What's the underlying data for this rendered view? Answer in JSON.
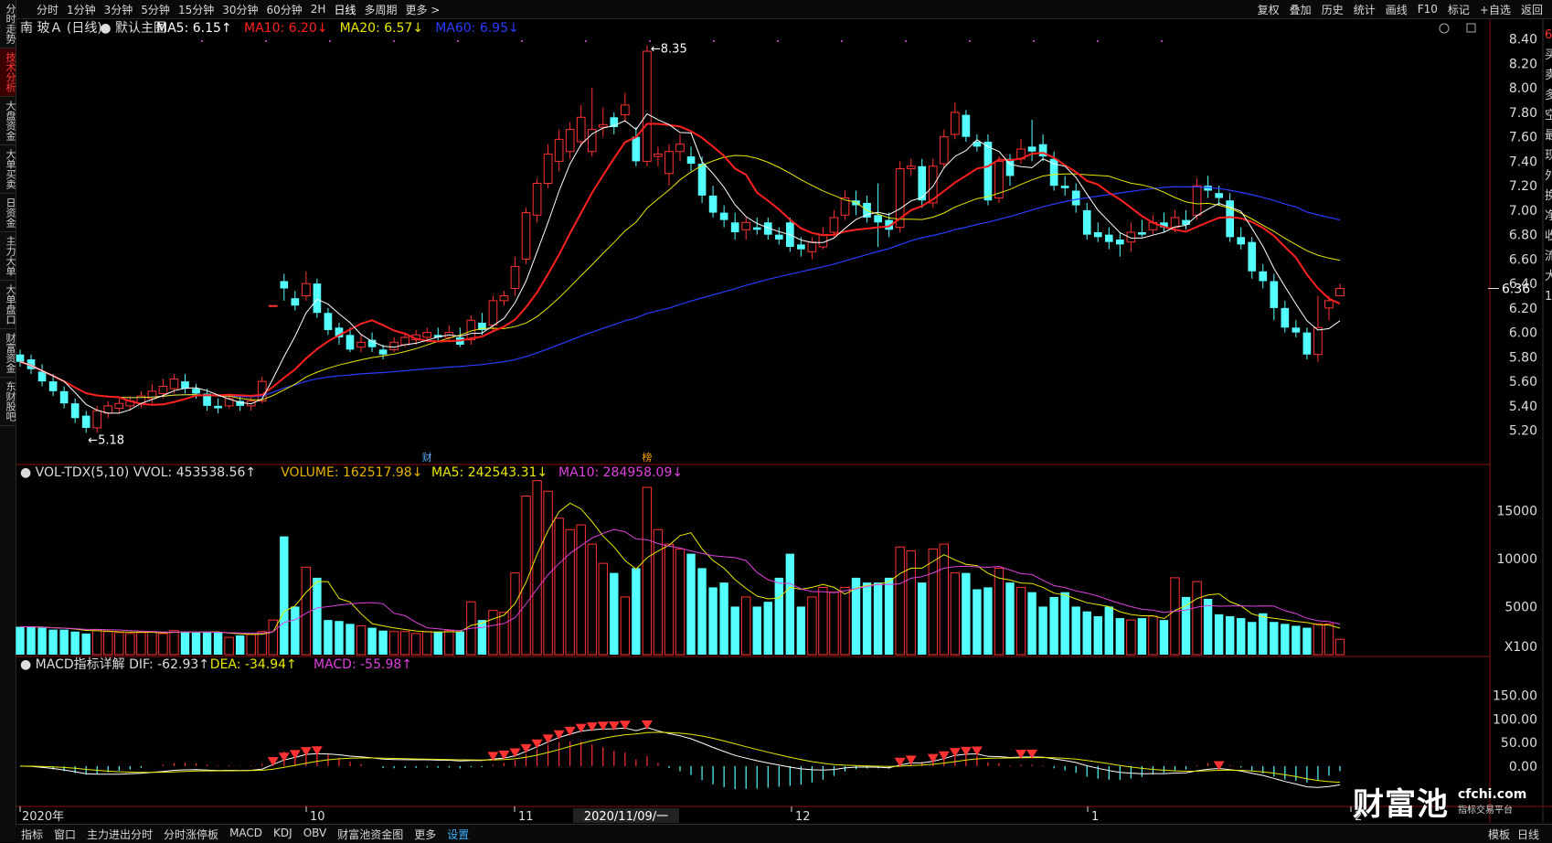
{
  "period_tabs": [
    "分时",
    "1分钟",
    "3分钟",
    "5分钟",
    "15分钟",
    "30分钟",
    "60分钟",
    "2H",
    "日线",
    "多周期",
    "更多 >"
  ],
  "active_period": "日线",
  "tool_tabs": [
    "复权",
    "叠加",
    "历史",
    "统计",
    "画线",
    "F10",
    "标记",
    "+自选",
    "返回"
  ],
  "sidebar": [
    "分时走势",
    "技术分析",
    "大盘资金",
    "大单买卖",
    "日资金",
    "主力大单",
    "大单盘口",
    "财富资金",
    "东财股吧"
  ],
  "active_side": "技术分析",
  "main_legend": [
    {
      "text": "南 玻Ａ (日线)",
      "color": "#dddddd"
    },
    {
      "text": "● 默认主图",
      "color": "#dddddd"
    },
    {
      "text": "MA5: 6.15↑",
      "color": "#ffffff"
    },
    {
      "text": "MA10: 6.20↓",
      "color": "#ff2020"
    },
    {
      "text": "MA20: 6.57↓",
      "color": "#e8e800"
    },
    {
      "text": "MA60: 6.95↓",
      "color": "#2a3cff"
    }
  ],
  "vol_legend": [
    {
      "text": "● VOL-TDX(5,10) VVOL: 453538.56↑",
      "color": "#dddddd"
    },
    {
      "text": "VOLUME: 162517.98↓",
      "color": "#e8b000"
    },
    {
      "text": "MA5: 242543.31↓",
      "color": "#e8e800"
    },
    {
      "text": "MA10: 284958.09↓",
      "color": "#e040e0"
    }
  ],
  "macd_legend": [
    {
      "text": "● MACD指标详解 DIF: -62.93↑",
      "color": "#dddddd"
    },
    {
      "text": "DEA: -34.94↑",
      "color": "#e8e800"
    },
    {
      "text": "MACD: -55.98↑",
      "color": "#e040e0"
    }
  ],
  "price_axis": [
    "8.40",
    "8.20",
    "8.00",
    "7.80",
    "7.60",
    "7.40",
    "7.20",
    "7.00",
    "6.80",
    "6.60",
    "6.40",
    "6.20",
    "6.00",
    "5.80",
    "5.60",
    "5.40",
    "5.20"
  ],
  "current_price": "6.36",
  "high_label": "8.35",
  "low_label": "5.18",
  "vol_axis": [
    "15000",
    "10000",
    "5000"
  ],
  "vol_unit": "X100",
  "macd_axis": [
    "150.00",
    "100.00",
    "50.00",
    "0.00"
  ],
  "date_axis": [
    "2020年",
    "10",
    "11",
    "2020/11/09/一",
    "12",
    "1",
    "2"
  ],
  "markers": {
    "cai": "财",
    "bang": "榜"
  },
  "right_edge_chars": [
    "6",
    "买",
    "卖",
    "多",
    "空",
    "最",
    "现",
    "外",
    "换",
    "净",
    "收",
    "流",
    "大",
    "1"
  ],
  "bottom_tabs": [
    "指标",
    "窗口",
    "主力进出分时",
    "分时涨停板",
    "MACD",
    "KDJ",
    "OBV",
    "财富池资金图",
    "更多",
    "设置"
  ],
  "bottom_right_tabs": [
    "模板",
    "日线"
  ],
  "watermark": {
    "main": "财富池",
    "url": "cfchi.com",
    "sub": "指标交易平台"
  },
  "chart_data": {
    "type": "candlestick",
    "title": "南 玻Ａ (日线)",
    "ylim": [
      5.1,
      8.45
    ],
    "candles": [
      [
        5.82,
        5.76,
        5.86,
        5.72
      ],
      [
        5.78,
        5.7,
        5.82,
        5.66
      ],
      [
        5.68,
        5.6,
        5.74,
        5.56
      ],
      [
        5.6,
        5.52,
        5.66,
        5.48
      ],
      [
        5.52,
        5.42,
        5.56,
        5.38
      ],
      [
        5.42,
        5.3,
        5.46,
        5.26
      ],
      [
        5.32,
        5.22,
        5.36,
        5.18
      ],
      [
        5.22,
        5.36,
        5.4,
        5.18
      ],
      [
        5.34,
        5.4,
        5.44,
        5.3
      ],
      [
        5.38,
        5.42,
        5.46,
        5.34
      ],
      [
        5.4,
        5.44,
        5.48,
        5.36
      ],
      [
        5.42,
        5.48,
        5.52,
        5.38
      ],
      [
        5.46,
        5.52,
        5.58,
        5.42
      ],
      [
        5.5,
        5.56,
        5.62,
        5.46
      ],
      [
        5.54,
        5.62,
        5.66,
        5.5
      ],
      [
        5.6,
        5.54,
        5.66,
        5.5
      ],
      [
        5.54,
        5.5,
        5.58,
        5.46
      ],
      [
        5.5,
        5.4,
        5.54,
        5.36
      ],
      [
        5.4,
        5.38,
        5.46,
        5.34
      ],
      [
        5.4,
        5.46,
        5.5,
        5.38
      ],
      [
        5.44,
        5.4,
        5.48,
        5.36
      ],
      [
        5.4,
        5.44,
        5.48,
        5.36
      ],
      [
        5.44,
        5.6,
        5.64,
        5.42
      ],
      [
        6.22,
        6.22,
        6.22,
        6.22
      ],
      [
        6.42,
        6.36,
        6.48,
        6.26
      ],
      [
        6.28,
        6.22,
        6.34,
        6.18
      ],
      [
        6.3,
        6.4,
        6.5,
        6.26
      ],
      [
        6.4,
        6.16,
        6.44,
        6.12
      ],
      [
        6.16,
        6.02,
        6.2,
        5.98
      ],
      [
        6.04,
        5.96,
        6.08,
        5.9
      ],
      [
        5.98,
        5.86,
        6.04,
        5.84
      ],
      [
        5.88,
        5.92,
        5.98,
        5.84
      ],
      [
        5.94,
        5.88,
        6.0,
        5.84
      ],
      [
        5.86,
        5.82,
        5.9,
        5.78
      ],
      [
        5.86,
        5.92,
        5.96,
        5.84
      ],
      [
        5.9,
        5.96,
        6.0,
        5.88
      ],
      [
        5.94,
        5.98,
        6.02,
        5.9
      ],
      [
        5.96,
        6.0,
        6.04,
        5.92
      ],
      [
        5.98,
        5.96,
        6.04,
        5.92
      ],
      [
        5.96,
        6.0,
        6.06,
        5.94
      ],
      [
        5.96,
        5.9,
        6.04,
        5.88
      ],
      [
        5.94,
        6.1,
        6.14,
        5.9
      ],
      [
        6.08,
        6.02,
        6.16,
        5.98
      ],
      [
        6.06,
        6.26,
        6.3,
        6.02
      ],
      [
        6.26,
        6.3,
        6.34,
        6.22
      ],
      [
        6.36,
        6.54,
        6.62,
        6.3
      ],
      [
        6.6,
        6.98,
        7.02,
        6.56
      ],
      [
        6.96,
        7.22,
        7.26,
        6.9
      ],
      [
        7.22,
        7.46,
        7.54,
        7.18
      ],
      [
        7.4,
        7.58,
        7.66,
        7.32
      ],
      [
        7.48,
        7.66,
        7.72,
        7.42
      ],
      [
        7.56,
        7.76,
        7.86,
        7.52
      ],
      [
        7.48,
        7.66,
        8.0,
        7.44
      ],
      [
        7.68,
        7.7,
        7.84,
        7.6
      ],
      [
        7.76,
        7.68,
        7.8,
        7.62
      ],
      [
        7.78,
        7.86,
        7.96,
        7.72
      ],
      [
        7.6,
        7.4,
        7.68,
        7.36
      ],
      [
        7.4,
        8.3,
        8.35,
        7.36
      ],
      [
        7.44,
        7.46,
        7.52,
        7.36
      ],
      [
        7.3,
        7.48,
        7.54,
        7.2
      ],
      [
        7.48,
        7.54,
        7.62,
        7.4
      ],
      [
        7.44,
        7.38,
        7.52,
        7.32
      ],
      [
        7.38,
        7.12,
        7.44,
        7.06
      ],
      [
        7.12,
        6.98,
        7.2,
        6.94
      ],
      [
        6.98,
        6.92,
        7.04,
        6.86
      ],
      [
        6.9,
        6.82,
        6.98,
        6.76
      ],
      [
        6.84,
        6.9,
        6.94,
        6.76
      ],
      [
        6.86,
        6.84,
        6.94,
        6.8
      ],
      [
        6.9,
        6.8,
        6.94,
        6.76
      ],
      [
        6.8,
        6.76,
        6.86,
        6.72
      ],
      [
        6.9,
        6.7,
        6.94,
        6.66
      ],
      [
        6.72,
        6.68,
        6.78,
        6.62
      ],
      [
        6.66,
        6.74,
        6.78,
        6.6
      ],
      [
        6.7,
        6.8,
        6.86,
        6.68
      ],
      [
        6.82,
        6.94,
        7.0,
        6.78
      ],
      [
        6.96,
        7.1,
        7.16,
        6.92
      ],
      [
        7.08,
        7.04,
        7.16,
        6.96
      ],
      [
        7.06,
        6.94,
        7.12,
        6.9
      ],
      [
        6.96,
        6.9,
        7.22,
        6.7
      ],
      [
        6.92,
        6.84,
        6.98,
        6.78
      ],
      [
        6.86,
        7.34,
        7.4,
        6.82
      ],
      [
        7.34,
        7.36,
        7.42,
        7.28
      ],
      [
        7.36,
        7.08,
        7.42,
        7.02
      ],
      [
        7.06,
        7.36,
        7.42,
        7.02
      ],
      [
        7.38,
        7.6,
        7.66,
        7.34
      ],
      [
        7.62,
        7.8,
        7.88,
        7.58
      ],
      [
        7.78,
        7.6,
        7.82,
        7.56
      ],
      [
        7.56,
        7.52,
        7.62,
        7.48
      ],
      [
        7.56,
        7.08,
        7.62,
        7.04
      ],
      [
        7.1,
        7.4,
        7.44,
        7.06
      ],
      [
        7.42,
        7.28,
        7.46,
        7.2
      ],
      [
        7.42,
        7.5,
        7.58,
        7.38
      ],
      [
        7.52,
        7.48,
        7.74,
        7.4
      ],
      [
        7.54,
        7.44,
        7.62,
        7.4
      ],
      [
        7.42,
        7.2,
        7.48,
        7.16
      ],
      [
        7.2,
        7.18,
        7.28,
        7.12
      ],
      [
        7.16,
        7.04,
        7.22,
        6.98
      ],
      [
        7.0,
        6.8,
        7.06,
        6.76
      ],
      [
        6.82,
        6.78,
        6.9,
        6.74
      ],
      [
        6.8,
        6.74,
        6.86,
        6.68
      ],
      [
        6.76,
        6.72,
        6.82,
        6.62
      ],
      [
        6.74,
        6.82,
        6.9,
        6.66
      ],
      [
        6.82,
        6.8,
        6.92,
        6.78
      ],
      [
        6.84,
        6.9,
        6.96,
        6.8
      ],
      [
        6.9,
        6.86,
        6.98,
        6.82
      ],
      [
        6.86,
        6.94,
        7.0,
        6.82
      ],
      [
        6.92,
        6.88,
        7.0,
        6.84
      ],
      [
        6.96,
        7.2,
        7.26,
        6.92
      ],
      [
        7.2,
        7.16,
        7.28,
        7.1
      ],
      [
        7.14,
        7.1,
        7.2,
        7.04
      ],
      [
        7.08,
        6.78,
        7.14,
        6.74
      ],
      [
        6.78,
        6.72,
        6.86,
        6.68
      ],
      [
        6.74,
        6.5,
        6.78,
        6.44
      ],
      [
        6.5,
        6.42,
        6.56,
        6.36
      ],
      [
        6.42,
        6.2,
        6.48,
        6.1
      ],
      [
        6.2,
        6.04,
        6.26,
        6.0
      ],
      [
        6.04,
        6.0,
        6.1,
        5.96
      ],
      [
        6.0,
        5.82,
        6.04,
        5.78
      ],
      [
        5.82,
        6.04,
        6.3,
        5.76
      ],
      [
        6.2,
        6.26,
        6.3,
        6.1
      ],
      [
        6.3,
        6.36,
        6.4,
        6.3
      ]
    ],
    "x_labels": [
      "2020年",
      "10",
      "11",
      "12",
      "1",
      "2"
    ],
    "volume": [
      2.9,
      2.9,
      2.8,
      2.6,
      2.6,
      2.4,
      2.2,
      2.6,
      2.4,
      2.3,
      2.2,
      2.3,
      2.4,
      2.2,
      2.5,
      2.4,
      2.3,
      2.4,
      2.3,
      1.8,
      2.0,
      2.1,
      2.4,
      3.6,
      12.3,
      5.0,
      9.1,
      8.0,
      3.6,
      3.5,
      3.2,
      3.0,
      2.8,
      2.5,
      2.4,
      2.4,
      2.2,
      2.4,
      2.4,
      2.5,
      2.4,
      5.5,
      3.6,
      4.6,
      4.4,
      8.5,
      16.5,
      18.1,
      17.0,
      14.2,
      13.0,
      13.5,
      11.5,
      9.5,
      8.5,
      6.0,
      9.0,
      17.4,
      13.0,
      11.5,
      11.0,
      10.5,
      9.0,
      7.0,
      7.5,
      5.0,
      6.0,
      5.0,
      5.5,
      8.0,
      10.5,
      5.0,
      6.0,
      7.0,
      6.5,
      7.0,
      8.0,
      7.5,
      7.5,
      8.0,
      11.2,
      10.8,
      7.5,
      11.0,
      11.5,
      8.5,
      8.5,
      6.8,
      7.0,
      9.0,
      7.5,
      7.0,
      6.5,
      5.0,
      6.0,
      6.5,
      5.0,
      4.5,
      4.0,
      5.0,
      3.8,
      3.6,
      3.8,
      4.0,
      3.6,
      8.0,
      6.0,
      7.6,
      5.8,
      4.2,
      4.0,
      3.8,
      3.4,
      4.3,
      3.4,
      3.2,
      3.0,
      2.8,
      3.2,
      3.2,
      1.6
    ],
    "vol_ylim": [
      0,
      17500
    ],
    "macd_ylim": [
      -70,
      180
    ]
  }
}
